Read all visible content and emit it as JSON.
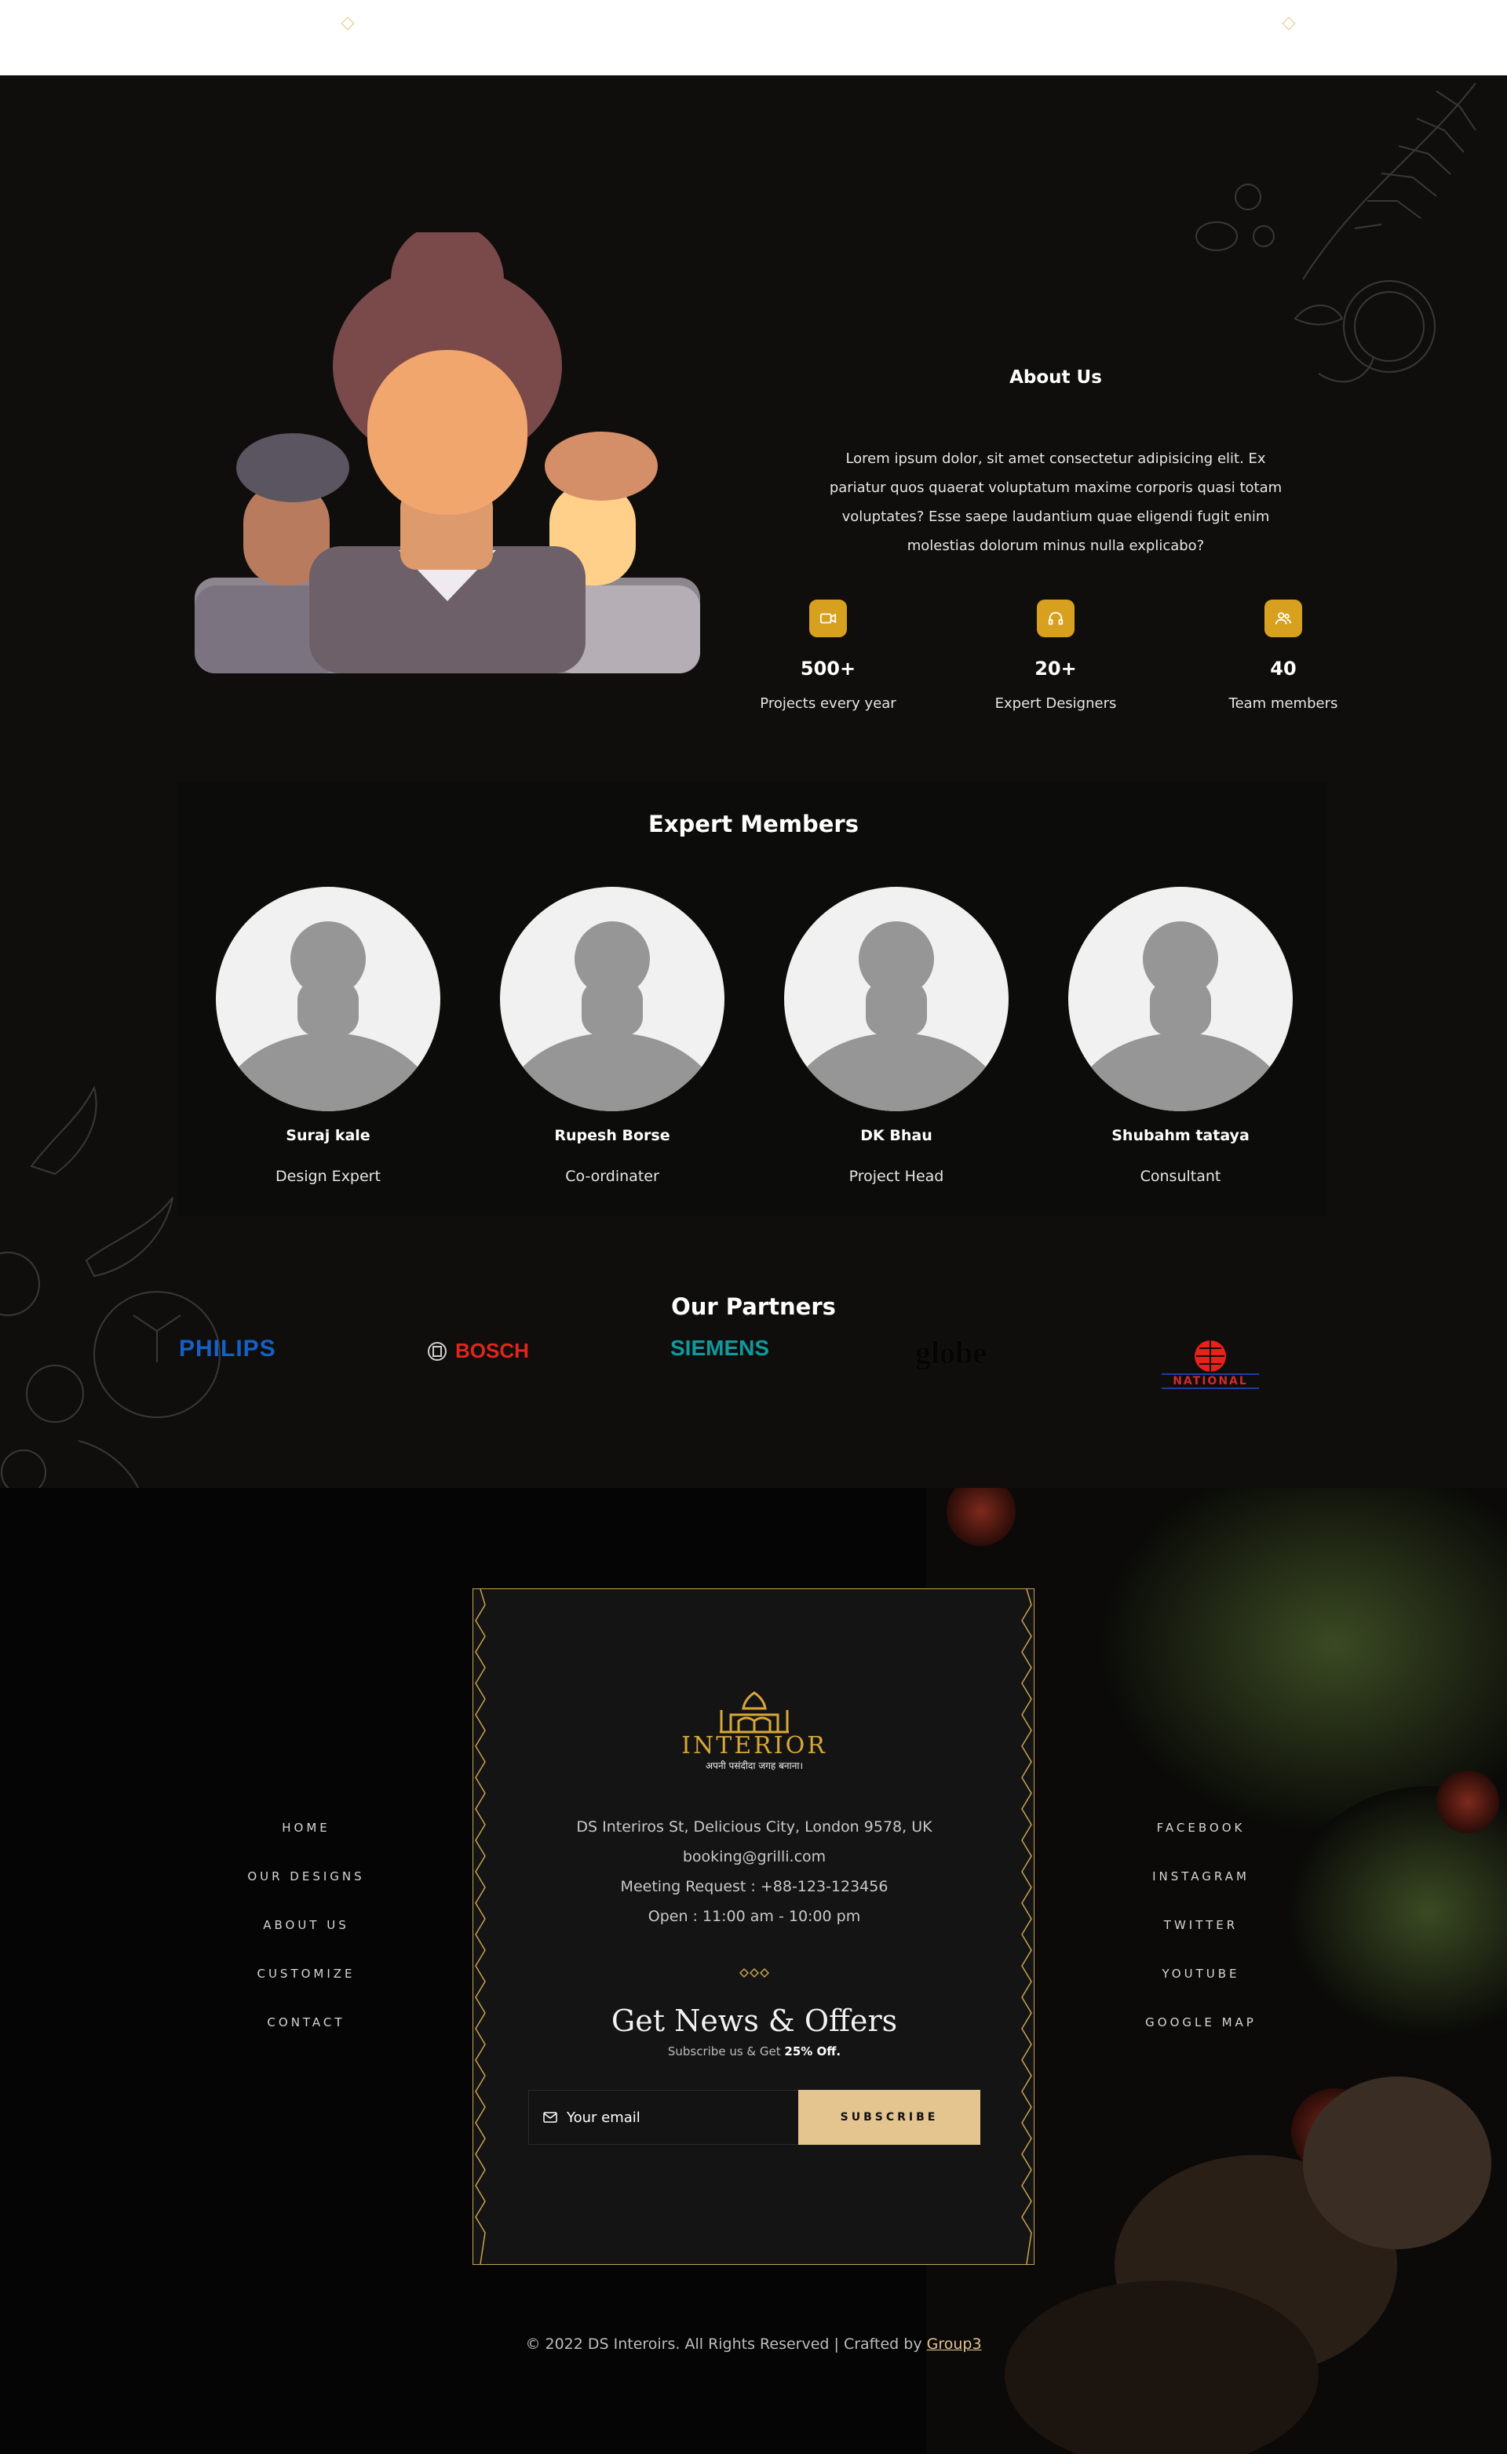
{
  "about": {
    "title": "About Us",
    "text": "Lorem ipsum dolor, sit amet consectetur adipisicing elit. Ex pariatur quos quaerat voluptatum maxime corporis quasi totam voluptates? Esse saepe laudantium quae eligendi fugit enim molestias dolorum minus nulla explicabo?",
    "stats": [
      {
        "icon": "video-icon",
        "value": "500+",
        "label": "Projects every year"
      },
      {
        "icon": "headphones-icon",
        "value": "20+",
        "label": "Expert Designers"
      },
      {
        "icon": "users-icon",
        "value": "40",
        "label": "Team members"
      }
    ]
  },
  "members": {
    "title": "Expert Members",
    "list": [
      {
        "name": "Suraj kale",
        "role": "Design Expert"
      },
      {
        "name": "Rupesh Borse",
        "role": "Co-ordinater"
      },
      {
        "name": "DK Bhau",
        "role": "Project Head"
      },
      {
        "name": "Shubahm tataya",
        "role": "Consultant"
      }
    ]
  },
  "partners": {
    "title": "Our Partners",
    "logos": [
      "PHILIPS",
      "BOSCH",
      "SIEMENS",
      "globe",
      "NATIONAL"
    ]
  },
  "footer": {
    "nav_left": [
      "HOME",
      "OUR DESIGNS",
      "ABOUT US",
      "CUSTOMIZE",
      "CONTACT"
    ],
    "nav_right": [
      "FACEBOOK",
      "INSTAGRAM",
      "TWITTER",
      "YOUTUBE",
      "GOOGLE MAP"
    ],
    "brand": "INTERIOR",
    "brand_tagline": "अपनी पसंदीदा जगह बनाना।",
    "address": "DS Interiros St, Delicious City, London 9578, UK",
    "email": "booking@grilli.com",
    "meeting": "Meeting Request : +88-123-123456",
    "hours": "Open : 11:00 am - 10:00 pm",
    "news_title": "Get News & Offers",
    "news_sub_prefix": "Subscribe us & Get ",
    "news_sub_bold": "25% Off.",
    "email_placeholder": "Your email",
    "subscribe_label": "SUBSCRIBE",
    "copyright": "© 2022 DS Interoirs. All Rights Reserved | Crafted by ",
    "credit": "Group3"
  },
  "colors": {
    "accent": "#d8a01f",
    "gold": "#e4c48f",
    "bg": "#0f0e0d"
  }
}
